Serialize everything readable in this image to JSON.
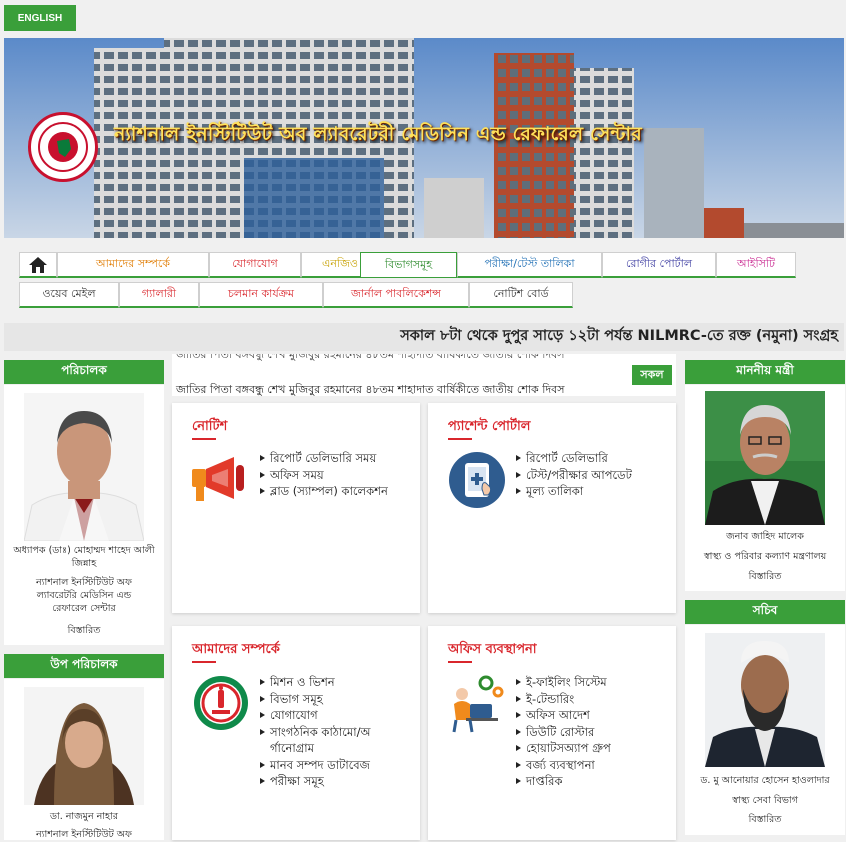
{
  "lang_button": "ENGLISH",
  "banner": {
    "title": "ন্যাশনাল ইনস্টিটিউট অব ল্যাবরেটরী মেডিসিন এন্ড রেফারেল সেন্টার"
  },
  "nav": {
    "home_icon": "home-icon",
    "items": [
      "আমাদের সম্পর্কে",
      "যোগাযোগ",
      "এনজিও",
      "বিভাগসমূহ",
      "পরীক্ষা/টেস্ট তালিকা",
      "রোগীর পোর্টাল",
      "আইসিটি",
      "ওয়েব মেইল",
      "গ্যালারী",
      "চলমান কার্যক্রম",
      "জার্নাল পাবলিকেশন্স",
      "নোটিশ বোর্ড"
    ]
  },
  "ticker": "সকাল ৮টা থেকে দুপুর সাড়ে ১২টা পর্যন্ত NILMRC-তে রক্ত (নমুনা) সংগ্রহ",
  "news": {
    "line1": "জাতির পিতা বঙ্গবন্ধু শেখ মুজিবুর রহমানের ৪৮তম শাহাদাত বার্ষিকীতে জাতীয় শোক দিবস",
    "all_label": "সকল"
  },
  "left": {
    "director": {
      "heading": "পরিচালক",
      "name": "অধ্যাপক (ডাঃ) মোহাম্মদ শাহেদ আলী জিন্নাহ",
      "org": "ন্যাশনাল ইনস্টিটিউট অফ ল্যাবরেটরি মেডিসিন এন্ড রেফারেল সেন্টার",
      "details": "বিস্তারিত"
    },
    "deputy": {
      "heading": "উপ পরিচালক",
      "name": "ডা. নাজমুন নাহার",
      "org": "ন্যাশনাল ইনস্টিটিউট অফ"
    }
  },
  "right": {
    "minister": {
      "heading": "মাননীয় মন্ত্রী",
      "name": "জনাব জাহিদ মালেক",
      "org": "স্বাস্থ্য ও পরিবার কল্যাণ মন্ত্রণালয়",
      "details": "বিস্তারিত"
    },
    "secretary": {
      "heading": "সচিব",
      "name": "ড. মু আনোয়ার হোসেন হাওলাদার",
      "org": "স্বাস্থ্য সেবা বিভাগ",
      "details": "বিস্তারিত"
    }
  },
  "cards": {
    "notice": {
      "title": "নোটিশ",
      "icon": "megaphone-icon",
      "items": [
        "রিপোর্ট ডেলিভারি সময়",
        "অফিস সময়",
        "ব্লাড (স্যাম্পল) কালেকশন"
      ]
    },
    "patient": {
      "title": "প্যাশেন্ট পোর্টাল",
      "icon": "tablet-touch-icon",
      "items": [
        "রিপোর্ট ডেলিভারি",
        "টেস্ট/পরীক্ষার আপডেট",
        "মূল্য তালিকা"
      ]
    },
    "about": {
      "title": "আমাদের সম্পর্কে",
      "icon": "institute-seal-icon",
      "items": [
        "মিশন ও ভিশন",
        "বিভাগ সমূহ",
        "যোগাযোগ",
        "সাংগঠনিক কাঠামো/অ\nর্গানোগ্রাম",
        "মানব সম্পদ ডাটাবেজ",
        "পরীক্ষা সমূহ"
      ]
    },
    "office": {
      "title": "অফিস ব্যবস্থাপনা",
      "icon": "office-worker-icon",
      "items": [
        "ই-ফাইলিং সিস্টেম",
        "ই-টেন্ডারিং",
        "অফিস আদেশ",
        "ডিউটি রোস্টার",
        "হোয়াটসঅ্যাপ গ্রুপ",
        "বর্জ্য ব্যবস্থাপনা",
        "দাপ্তরিক"
      ]
    }
  },
  "colors": {
    "green": "#3a9f3a",
    "red": "#d9262c"
  }
}
